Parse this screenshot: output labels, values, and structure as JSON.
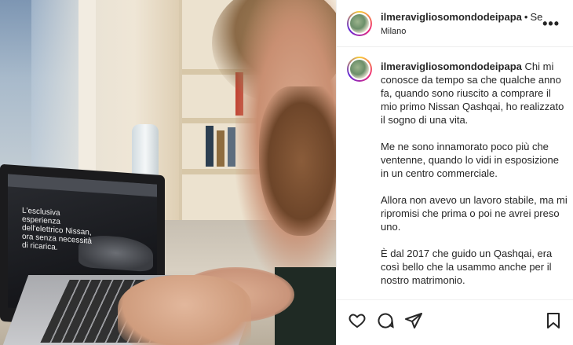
{
  "post": {
    "username": "ilmeravigliosomondodeipapa",
    "separator": "•",
    "follow_label": "Se",
    "location": "Milano",
    "more_icon": "more-dots-icon"
  },
  "photo": {
    "screen_text": "L'esclusiva esperienza dell'elettrico Nissan, ora senza necessità di ricarica."
  },
  "caption": {
    "username": "ilmeravigliosomondodeipapa",
    "paragraphs": [
      "Chi mi conosce da tempo sa che qualche anno fa, quando sono riuscito a comprare il mio primo Nissan Qashqai, ho realizzato il sogno di una vita.",
      "Me ne sono innamorato poco più che ventenne, quando lo vidi in esposizione in un centro commerciale.",
      "Allora non avevo un lavoro stabile, ma mi ripromisi che prima o poi ne avrei preso uno.",
      "È dal 2017 che guido un Qashqai, era così bello che la usammo anche per il nostro matrimonio."
    ]
  },
  "actions": {
    "icons": [
      "heart-icon",
      "comment-icon",
      "share-icon",
      "bookmark-icon"
    ]
  }
}
